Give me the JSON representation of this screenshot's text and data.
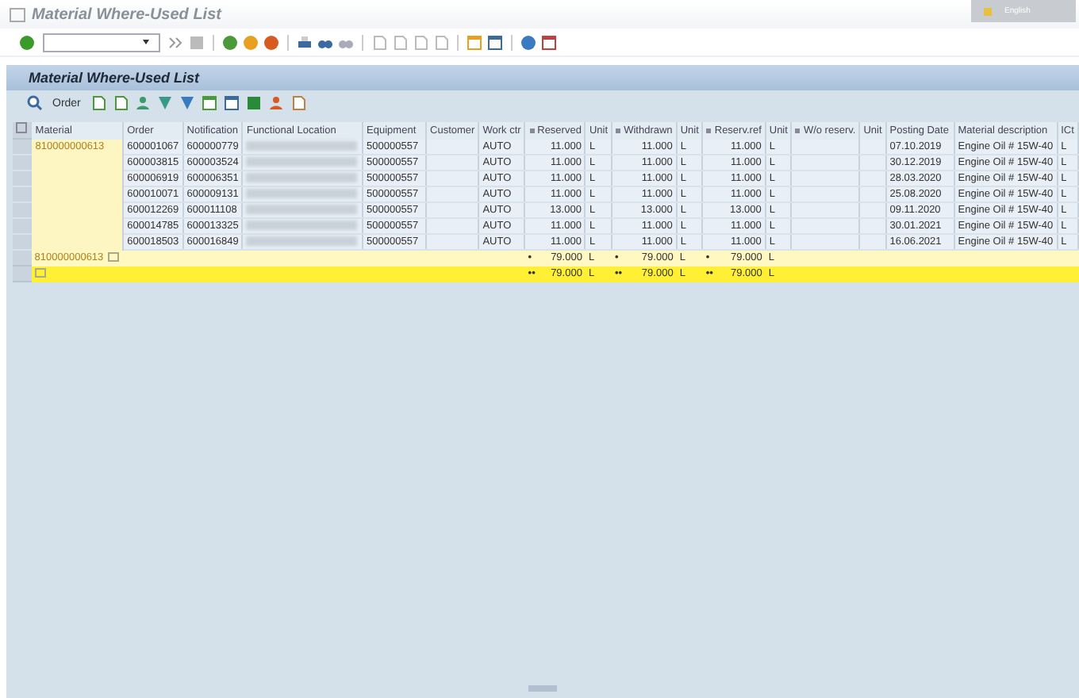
{
  "window": {
    "title": "Material Where-Used List",
    "language": "English"
  },
  "screen_title": "Material Where-Used List",
  "app_toolbar": {
    "buttons": [
      "Order"
    ]
  },
  "table": {
    "columns": [
      {
        "label": "Material",
        "sum": false
      },
      {
        "label": "Order",
        "sum": false
      },
      {
        "label": "Notification",
        "sum": false
      },
      {
        "label": "Functional Location",
        "sum": false
      },
      {
        "label": "Equipment",
        "sum": false
      },
      {
        "label": "Customer",
        "sum": false
      },
      {
        "label": "Work ctr",
        "sum": false
      },
      {
        "label": "Reserved",
        "sum": true
      },
      {
        "label": "Unit",
        "sum": false
      },
      {
        "label": "Withdrawn",
        "sum": true
      },
      {
        "label": "Unit",
        "sum": false
      },
      {
        "label": "Reserv.ref",
        "sum": true
      },
      {
        "label": "Unit",
        "sum": false
      },
      {
        "label": "W/o reserv.",
        "sum": true
      },
      {
        "label": "Unit",
        "sum": false
      },
      {
        "label": "Posting Date",
        "sum": false
      },
      {
        "label": "Material description",
        "sum": false
      },
      {
        "label": "ICt",
        "sum": false
      }
    ],
    "rows": [
      {
        "kind": "item",
        "cells": [
          "810000000613",
          "600001067",
          "600000779",
          "",
          "500000557",
          "",
          "AUTO",
          "11.000",
          "L",
          "11.000",
          "L",
          "11.000",
          "L",
          "",
          "",
          "07.10.2019",
          "Engine Oil # 15W-40",
          "L"
        ]
      },
      {
        "kind": "item",
        "cells": [
          "",
          "600003815",
          "600003524",
          "",
          "500000557",
          "",
          "AUTO",
          "11.000",
          "L",
          "11.000",
          "L",
          "11.000",
          "L",
          "",
          "",
          "30.12.2019",
          "Engine Oil # 15W-40",
          "L"
        ]
      },
      {
        "kind": "item",
        "cells": [
          "",
          "600006919",
          "600006351",
          "",
          "500000557",
          "",
          "AUTO",
          "11.000",
          "L",
          "11.000",
          "L",
          "11.000",
          "L",
          "",
          "",
          "28.03.2020",
          "Engine Oil # 15W-40",
          "L"
        ]
      },
      {
        "kind": "item",
        "cells": [
          "",
          "600010071",
          "600009131",
          "",
          "500000557",
          "",
          "AUTO",
          "11.000",
          "L",
          "11.000",
          "L",
          "11.000",
          "L",
          "",
          "",
          "25.08.2020",
          "Engine Oil # 15W-40",
          "L"
        ]
      },
      {
        "kind": "item",
        "cells": [
          "",
          "600012269",
          "600011108",
          "",
          "500000557",
          "",
          "AUTO",
          "13.000",
          "L",
          "13.000",
          "L",
          "13.000",
          "L",
          "",
          "",
          "09.11.2020",
          "Engine Oil # 15W-40",
          "L"
        ]
      },
      {
        "kind": "item",
        "cells": [
          "",
          "600014785",
          "600013325",
          "",
          "500000557",
          "",
          "AUTO",
          "11.000",
          "L",
          "11.000",
          "L",
          "11.000",
          "L",
          "",
          "",
          "30.01.2021",
          "Engine Oil # 15W-40",
          "L"
        ]
      },
      {
        "kind": "item",
        "cells": [
          "",
          "600018503",
          "600016849",
          "",
          "500000557",
          "",
          "AUTO",
          "11.000",
          "L",
          "11.000",
          "L",
          "11.000",
          "L",
          "",
          "",
          "16.06.2021",
          "Engine Oil # 15W-40",
          "L"
        ]
      },
      {
        "kind": "subtotal",
        "marker": "•",
        "cells": [
          "810000000613",
          "",
          "",
          "",
          "",
          "",
          "",
          "79.000",
          "L",
          "79.000",
          "L",
          "79.000",
          "L",
          "",
          "",
          "",
          "",
          ""
        ]
      },
      {
        "kind": "total",
        "marker": "••",
        "cells": [
          "",
          "",
          "",
          "",
          "",
          "",
          "",
          "79.000",
          "L",
          "79.000",
          "L",
          "79.000",
          "L",
          "",
          "",
          "",
          "",
          ""
        ]
      }
    ]
  }
}
